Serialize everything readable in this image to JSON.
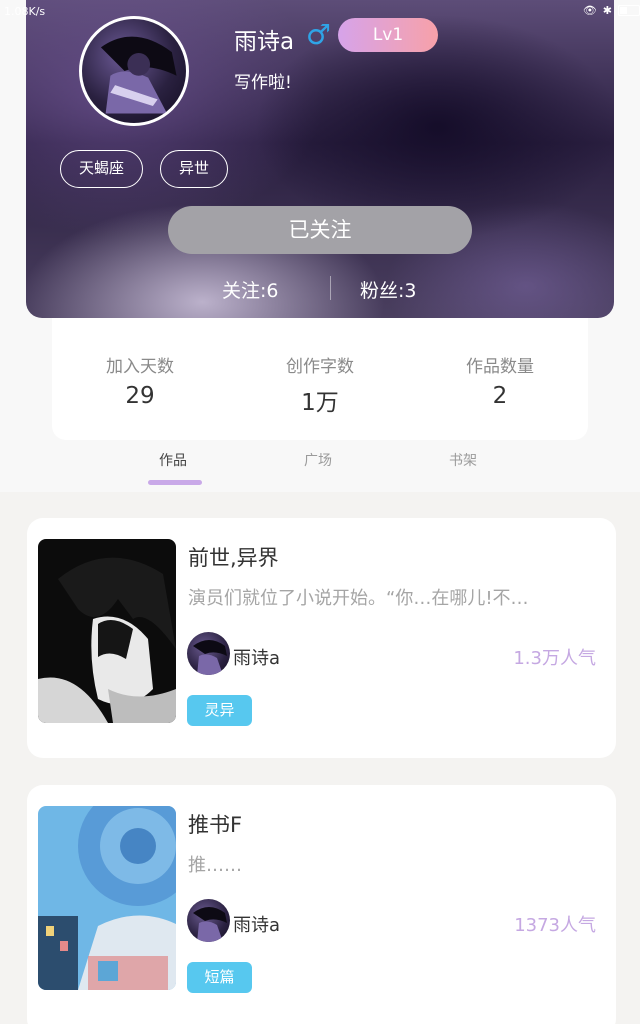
{
  "status_bar": {
    "network_speed": "1.08K/s"
  },
  "profile": {
    "username": "雨诗a",
    "gender_symbol": "♂",
    "level": "Lv1",
    "signature": "写作啦!",
    "tags": [
      "天蝎座",
      "异世"
    ],
    "follow_button_label": "已关注",
    "following_label": "关注:6",
    "followers_label": "粉丝:3"
  },
  "stats": [
    {
      "label": "加入天数",
      "value": "29"
    },
    {
      "label": "创作字数",
      "value": "1万"
    },
    {
      "label": "作品数量",
      "value": "2"
    }
  ],
  "tabs": [
    "作品",
    "广场",
    "书架"
  ],
  "active_tab": "作品",
  "works": [
    {
      "title": "前世,异界",
      "excerpt": "演员们就位了小说开始。“你…在哪儿!不…",
      "author": "雨诗a",
      "popularity": "1.3万人气",
      "category": "灵异",
      "category_color": "#57c8ef"
    },
    {
      "title": "推书F",
      "excerpt": "推……",
      "author": "雨诗a",
      "popularity": "1373人气",
      "category": "短篇",
      "category_color": "#57c8ef"
    }
  ],
  "colors": {
    "accent_purple": "#c5a8e2",
    "tab_indicator": "#c9a9e8",
    "badge_blue": "#57c8ef",
    "follow_button": "#a3a2a7"
  }
}
